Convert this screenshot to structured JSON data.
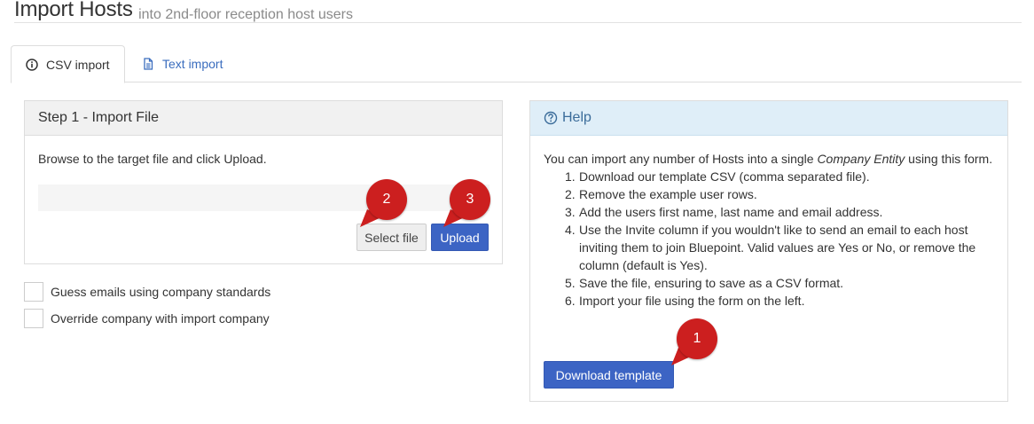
{
  "header": {
    "title": "Import Hosts",
    "subtitle": "into 2nd-floor reception host users"
  },
  "tabs": [
    {
      "label": "CSV import",
      "icon": "info-circle-icon",
      "active": true
    },
    {
      "label": "Text import",
      "icon": "document-icon",
      "active": false
    }
  ],
  "step1": {
    "heading": "Step 1 - Import File",
    "instruction": "Browse to the target file and click Upload.",
    "select_label": "Select file",
    "upload_label": "Upload"
  },
  "options": [
    {
      "label": "Guess emails using company standards",
      "checked": false
    },
    {
      "label": "Override company with import company",
      "checked": false
    }
  ],
  "help": {
    "heading": "Help",
    "intro_prefix": "You can import any number of Hosts into a single ",
    "intro_emphasis": "Company Entity",
    "intro_suffix": " using this form.",
    "steps": [
      "Download our template CSV (comma separated file).",
      "Remove the example user rows.",
      "Add the users first name, last name and email address.",
      "Use the Invite column if you wouldn't like to send an email to each host inviting them to join Bluepoint. Valid values are Yes or No, or remove the column (default is Yes).",
      "Save the file, ensuring to save as a CSV format.",
      "Import your file using the form on the left."
    ],
    "download_label": "Download template"
  },
  "callouts": [
    "1",
    "2",
    "3"
  ],
  "colors": {
    "primary": "#3c64c4",
    "link": "#3a6dbe",
    "help_heading_bg": "#dfeef8",
    "callout": "#cc1f1f"
  }
}
